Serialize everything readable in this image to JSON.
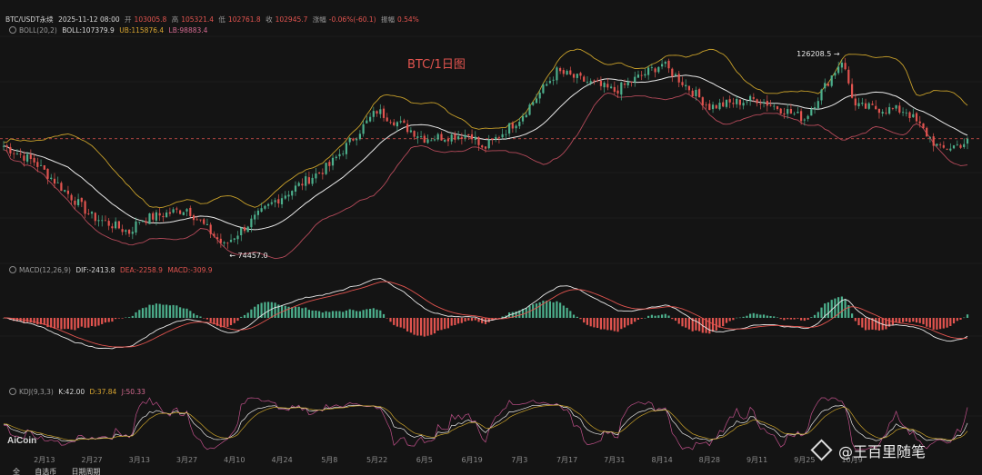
{
  "header": {
    "symbol": "BTC/USDT永续",
    "datetime": "2025-11-12 08:00",
    "open_label": "开",
    "open": "103005.8",
    "high_label": "高",
    "high": "105321.4",
    "low_label": "低",
    "low": "102761.8",
    "close_label": "收",
    "close": "102945.7",
    "change_label": "涨幅",
    "change": "-0.06%(-60.1)",
    "amp_label": "振幅",
    "amp": "0.54%"
  },
  "boll": {
    "label": "BOLL(20,2)",
    "mid": "BOLL:107379.9",
    "ub": "UB:115876.4",
    "lb": "LB:98883.4"
  },
  "macd": {
    "label": "MACD(12,26,9)",
    "dif": "DIF:-2413.8",
    "dea": "DEA:-2258.9",
    "macd": "MACD:-309.9"
  },
  "kdj": {
    "label": "KDJ(9,3,3)",
    "k": "K:42.00",
    "d": "D:37.84",
    "j": "J:50.33"
  },
  "title": "BTC/1日图",
  "logo": "AiCoin",
  "watermark": "@王百里随笔",
  "bottom_tabs": [
    "全",
    "自选币",
    "日期周期"
  ],
  "colors": {
    "bg": "#141414",
    "up": "#4caf8c",
    "down": "#e2544f",
    "mid": "#e8e8e8",
    "ub": "#c8a02a",
    "lb": "#b54a5a",
    "grid": "#222222"
  },
  "chart_data": {
    "type": "candlestick",
    "title": "BTC/1日图",
    "x_ticks": [
      "2月13",
      "2月27",
      "3月13",
      "3月27",
      "4月10",
      "4月24",
      "5月8",
      "5月22",
      "6月5",
      "6月19",
      "7月3",
      "7月17",
      "7月31",
      "8月14",
      "8月28",
      "9月11",
      "9月25",
      "10月9"
    ],
    "price_annotations": [
      {
        "label": "126208.5",
        "value": 126208.5
      },
      {
        "label": "74457.0",
        "value": 74457.0
      }
    ],
    "price_series": {
      "name": "close",
      "date_range": [
        "2025-02-01",
        "2025-11-12"
      ],
      "anchors": [
        {
          "x": "2025-02-01",
          "y": 102000
        },
        {
          "x": "2025-02-10",
          "y": 98000
        },
        {
          "x": "2025-02-27",
          "y": 84000
        },
        {
          "x": "2025-03-10",
          "y": 80000
        },
        {
          "x": "2025-03-13",
          "y": 83000
        },
        {
          "x": "2025-03-27",
          "y": 86000
        },
        {
          "x": "2025-04-07",
          "y": 76500
        },
        {
          "x": "2025-04-10",
          "y": 79000
        },
        {
          "x": "2025-04-22",
          "y": 88000
        },
        {
          "x": "2025-05-08",
          "y": 97000
        },
        {
          "x": "2025-05-22",
          "y": 111000
        },
        {
          "x": "2025-06-05",
          "y": 104000
        },
        {
          "x": "2025-06-19",
          "y": 105000
        },
        {
          "x": "2025-06-22",
          "y": 101000
        },
        {
          "x": "2025-07-03",
          "y": 109000
        },
        {
          "x": "2025-07-14",
          "y": 121000
        },
        {
          "x": "2025-07-31",
          "y": 116000
        },
        {
          "x": "2025-08-14",
          "y": 123000
        },
        {
          "x": "2025-08-28",
          "y": 112000
        },
        {
          "x": "2025-09-11",
          "y": 114000
        },
        {
          "x": "2025-09-25",
          "y": 109000
        },
        {
          "x": "2025-10-06",
          "y": 124000
        },
        {
          "x": "2025-10-10",
          "y": 112000
        },
        {
          "x": "2025-10-25",
          "y": 111000
        },
        {
          "x": "2025-11-04",
          "y": 101000
        },
        {
          "x": "2025-11-12",
          "y": 103000
        }
      ]
    },
    "ylim": [
      72000,
      130000
    ],
    "macd_ylim": [
      -9000,
      6000
    ],
    "kdj_ylim": [
      -10,
      110
    ]
  }
}
